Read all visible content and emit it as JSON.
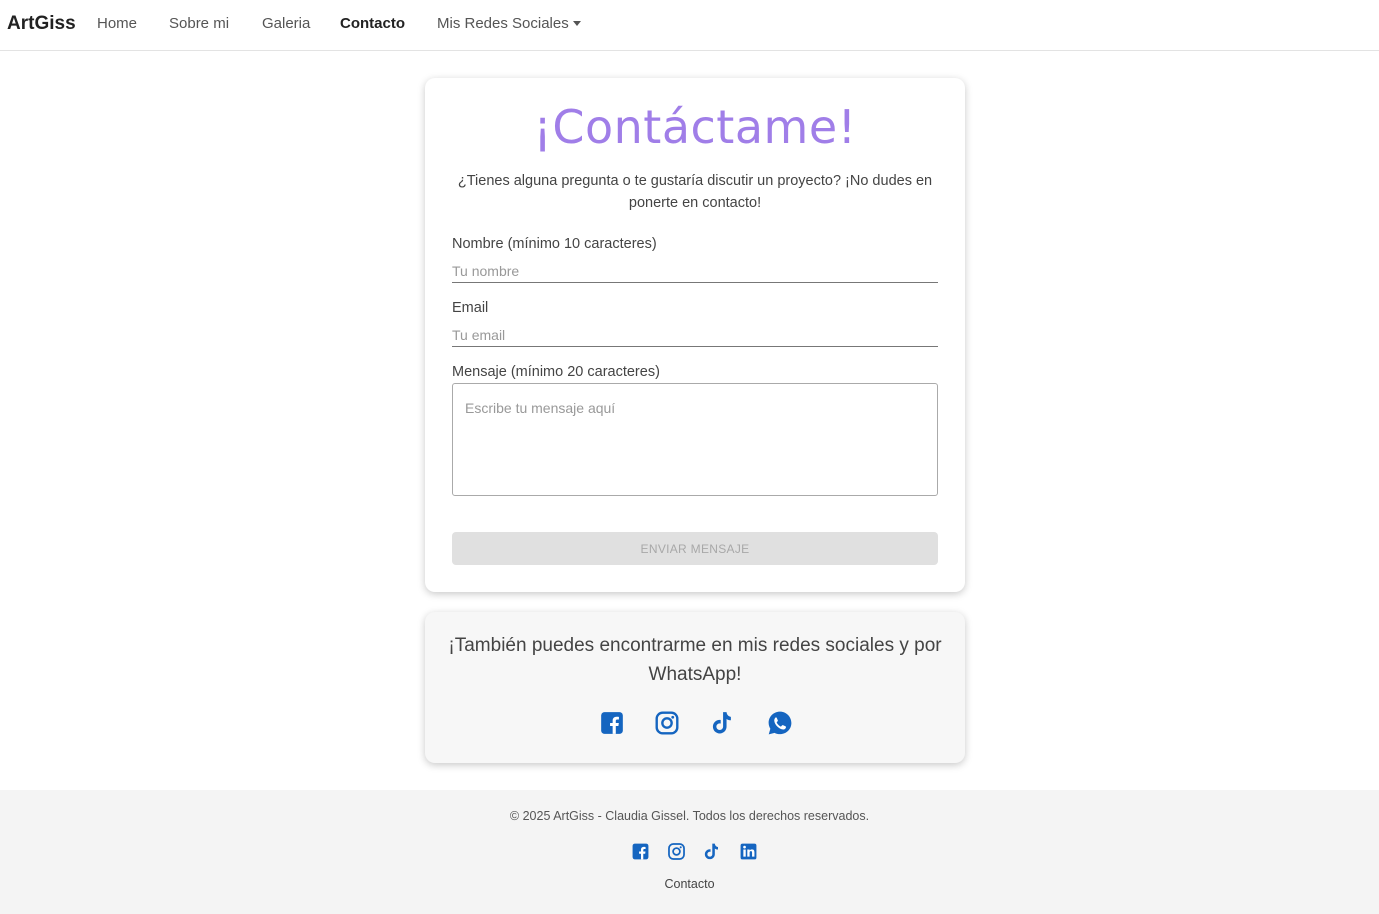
{
  "navbar": {
    "brand": "ArtGiss",
    "links": [
      "Home",
      "Sobre mi",
      "Galeria",
      "Contacto"
    ],
    "dropdown_label": "Mis Redes Sociales",
    "active": "Contacto"
  },
  "contact_card": {
    "title": "¡Contáctame!",
    "intro": "¿Tienes alguna pregunta o te gustaría discutir un proyecto? ¡No dudes en ponerte en contacto!",
    "name_label": "Nombre (mínimo 10 caracteres)",
    "name_placeholder": "Tu nombre",
    "email_label": "Email",
    "email_placeholder": "Tu email",
    "message_label": "Mensaje (mínimo 20 caracteres)",
    "message_placeholder": "Escribe tu mensaje aquí",
    "submit_label": "ENVIAR MENSAJE"
  },
  "social_card": {
    "text": "¡También puedes encontrarme en mis redes sociales y por WhatsApp!",
    "icons": [
      "facebook-icon",
      "instagram-icon",
      "tiktok-icon",
      "whatsapp-icon"
    ]
  },
  "footer": {
    "copyright": "© 2025 ArtGiss - Claudia Gissel. Todos los derechos reservados.",
    "icons": [
      "facebook-icon",
      "instagram-icon",
      "tiktok-icon",
      "linkedin-icon"
    ],
    "link": "Contacto"
  },
  "colors": {
    "accent": "#a07ee8",
    "icon_blue": "#1565c0",
    "footer_bg": "#f4f4f4",
    "button_disabled": "#e0e0e0"
  }
}
